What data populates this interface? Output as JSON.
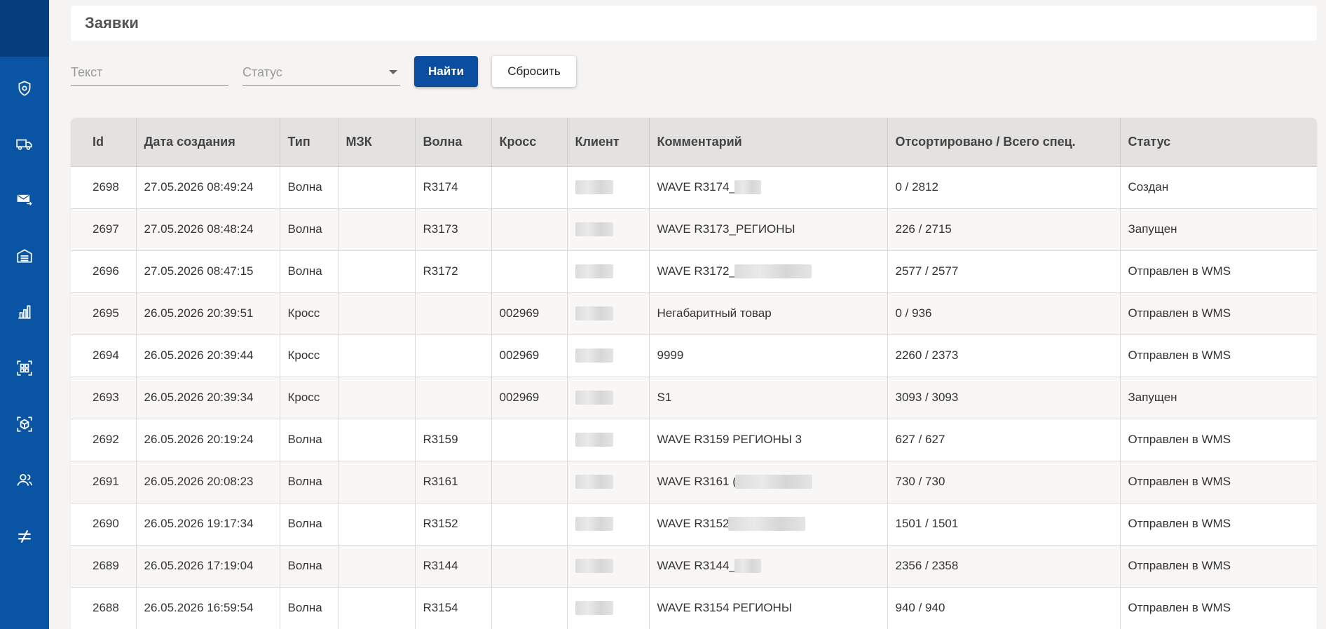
{
  "header": {
    "title": "Заявки"
  },
  "filters": {
    "text_placeholder": "Текст",
    "status_placeholder": "Статус",
    "find_label": "Найти",
    "reset_label": "Сбросить"
  },
  "sidebar": {
    "items": [
      {
        "icon": "shield-icon"
      },
      {
        "icon": "truck-icon"
      },
      {
        "icon": "mail-forward-icon"
      },
      {
        "icon": "warehouse-icon"
      },
      {
        "icon": "bar-chart-icon"
      },
      {
        "icon": "qr-scan-icon"
      },
      {
        "icon": "package-scan-icon"
      },
      {
        "icon": "users-icon"
      },
      {
        "icon": "not-equal-icon"
      }
    ]
  },
  "table": {
    "columns": [
      "Id",
      "Дата создания",
      "Тип",
      "МЗК",
      "Волна",
      "Кросс",
      "Клиент",
      "Комментарий",
      "Отсортировано / Всего спец.",
      "Статус"
    ],
    "rows": [
      {
        "id": "2698",
        "date": "27.05.2026 08:49:24",
        "type": "Волна",
        "mzk": "",
        "wave": "R3174",
        "cross": "",
        "client": "",
        "comment": "WAVE R3174_",
        "comment_redacted": "short",
        "sorted": "0 / 2812",
        "status": "Создан"
      },
      {
        "id": "2697",
        "date": "27.05.2026 08:48:24",
        "type": "Волна",
        "mzk": "",
        "wave": "R3173",
        "cross": "",
        "client": "",
        "comment": "WAVE R3173_РЕГИОНЫ",
        "comment_redacted": "",
        "sorted": "226 / 2715",
        "status": "Запущен"
      },
      {
        "id": "2696",
        "date": "27.05.2026 08:47:15",
        "type": "Волна",
        "mzk": "",
        "wave": "R3172",
        "cross": "",
        "client": "",
        "comment": "WAVE R3172_",
        "comment_redacted": "long",
        "sorted": "2577 / 2577",
        "status": "Отправлен в WMS"
      },
      {
        "id": "2695",
        "date": "26.05.2026 20:39:51",
        "type": "Кросс",
        "mzk": "",
        "wave": "",
        "cross": "002969",
        "client": "",
        "comment": "Негабаритный товар",
        "comment_redacted": "",
        "sorted": "0 / 936",
        "status": "Отправлен в WMS"
      },
      {
        "id": "2694",
        "date": "26.05.2026 20:39:44",
        "type": "Кросс",
        "mzk": "",
        "wave": "",
        "cross": "002969",
        "client": "",
        "comment": "9999",
        "comment_redacted": "",
        "sorted": "2260 / 2373",
        "status": "Отправлен в WMS"
      },
      {
        "id": "2693",
        "date": "26.05.2026 20:39:34",
        "type": "Кросс",
        "mzk": "",
        "wave": "",
        "cross": "002969",
        "client": "",
        "comment": "S1",
        "comment_redacted": "",
        "sorted": "3093 / 3093",
        "status": "Запущен"
      },
      {
        "id": "2692",
        "date": "26.05.2026 20:19:24",
        "type": "Волна",
        "mzk": "",
        "wave": "R3159",
        "cross": "",
        "client": "",
        "comment": "WAVE R3159 РЕГИОНЫ 3",
        "comment_redacted": "",
        "sorted": "627 / 627",
        "status": "Отправлен в WMS"
      },
      {
        "id": "2691",
        "date": "26.05.2026 20:08:23",
        "type": "Волна",
        "mzk": "",
        "wave": "R3161",
        "cross": "",
        "client": "",
        "comment": "WAVE R3161 (",
        "comment_redacted": "long",
        "sorted": "730 / 730",
        "status": "Отправлен в WMS"
      },
      {
        "id": "2690",
        "date": "26.05.2026 19:17:34",
        "type": "Волна",
        "mzk": "",
        "wave": "R3152",
        "cross": "",
        "client": "",
        "comment": "WAVE R3152",
        "comment_redacted": "long",
        "sorted": "1501 / 1501",
        "status": "Отправлен в WMS"
      },
      {
        "id": "2689",
        "date": "26.05.2026 17:19:04",
        "type": "Волна",
        "mzk": "",
        "wave": "R3144",
        "cross": "",
        "client": "",
        "comment": "WAVE R3144_",
        "comment_redacted": "short",
        "sorted": "2356 / 2358",
        "status": "Отправлен в WMS"
      },
      {
        "id": "2688",
        "date": "26.05.2026 16:59:54",
        "type": "Волна",
        "mzk": "",
        "wave": "R3154",
        "cross": "",
        "client": "",
        "comment": "WAVE R3154 РЕГИОНЫ",
        "comment_redacted": "",
        "sorted": "940 / 940",
        "status": "Отправлен в WMS"
      }
    ]
  },
  "colors": {
    "sidebar": "#0a55a3",
    "sidebar_top": "#073f7d",
    "primary_button": "#0b4ea1",
    "table_header": "#e3e2e0",
    "page_background": "#f5f4f2"
  }
}
